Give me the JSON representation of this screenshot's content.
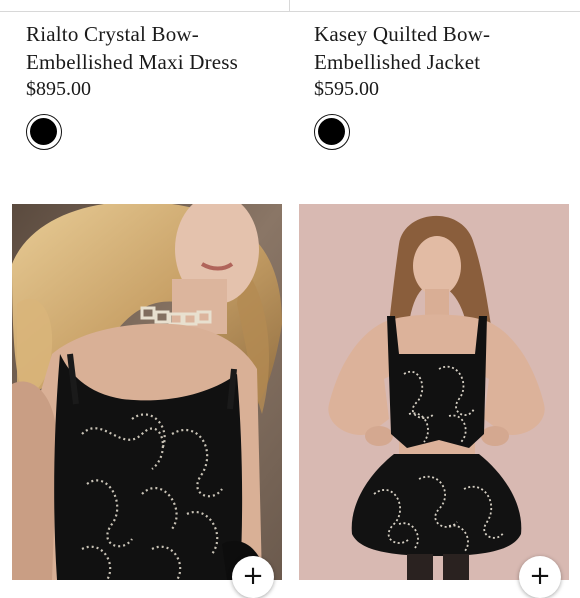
{
  "products": [
    {
      "name_line1": "Rialto Crystal Bow-",
      "name_line2": "Embellished Maxi Dress",
      "price": "$895.00",
      "swatch_color": "#000000",
      "add_label": "+"
    },
    {
      "name_line1": "Kasey Quilted Bow-",
      "name_line2": "Embellished Jacket",
      "price": "$595.00",
      "swatch_color": "#000000",
      "add_label": "+"
    }
  ],
  "colors": {
    "photo1_background": "#7a6a5d",
    "photo2_background": "#d5b5ae",
    "garment": "#111111"
  }
}
